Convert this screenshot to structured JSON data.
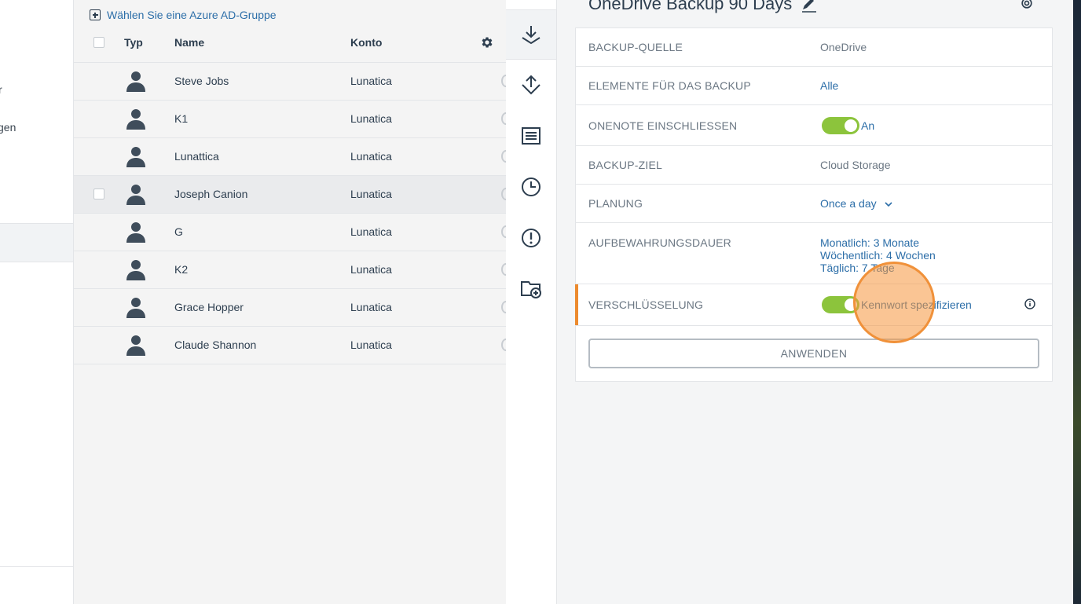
{
  "sidebar": {
    "items": [
      {
        "label": "r"
      },
      {
        "label": "gen"
      }
    ],
    "selected_label": "",
    "bottom_label": "."
  },
  "list": {
    "add_group_label": "Wählen Sie eine Azure AD-Gruppe",
    "columns": {
      "type": "Typ",
      "name": "Name",
      "account": "Konto"
    },
    "rows": [
      {
        "name": "Steve Jobs",
        "account": "Lunatica"
      },
      {
        "name": "K1",
        "account": "Lunatica"
      },
      {
        "name": "Lunattica",
        "account": "Lunatica"
      },
      {
        "name": "Joseph Canion",
        "account": "Lunatica"
      },
      {
        "name": "G",
        "account": "Lunatica"
      },
      {
        "name": "K2",
        "account": "Lunatica"
      },
      {
        "name": "Grace Hopper",
        "account": "Lunatica"
      },
      {
        "name": "Claude Shannon",
        "account": "Lunatica"
      }
    ]
  },
  "iconstrip": {
    "icons": [
      "download-icon",
      "recovery-icon",
      "activity-log-icon",
      "history-icon",
      "alert-icon",
      "add-folder-icon"
    ]
  },
  "panel": {
    "title": "OneDrive Backup 90 Days",
    "rows": {
      "source": {
        "label": "BACKUP-QUELLE",
        "value": "OneDrive"
      },
      "items": {
        "label": "ELEMENTE FÜR DAS BACKUP",
        "value": "Alle"
      },
      "onenote": {
        "label": "ONENOTE EINSCHLIESSEN",
        "value": "An"
      },
      "destination": {
        "label": "BACKUP-ZIEL",
        "value": "Cloud Storage"
      },
      "schedule": {
        "label": "PLANUNG",
        "value": "Once a day"
      },
      "retention": {
        "label": "AUFBEWAHRUNGSDAUER",
        "monthly": "Monatlich: 3 Monate",
        "weekly": "Wöchentlich: 4 Wochen",
        "daily": "Täglich: 7 Tage"
      },
      "encryption": {
        "label": "VERSCHLÜSSELUNG",
        "value": "Kennwort spezifizieren"
      }
    },
    "apply_label": "ANWENDEN"
  },
  "colors": {
    "toggle_on": "#8cc43c",
    "link": "#2c6ea8",
    "accent": "#ec8a2e",
    "text": "#2d3e4f"
  }
}
